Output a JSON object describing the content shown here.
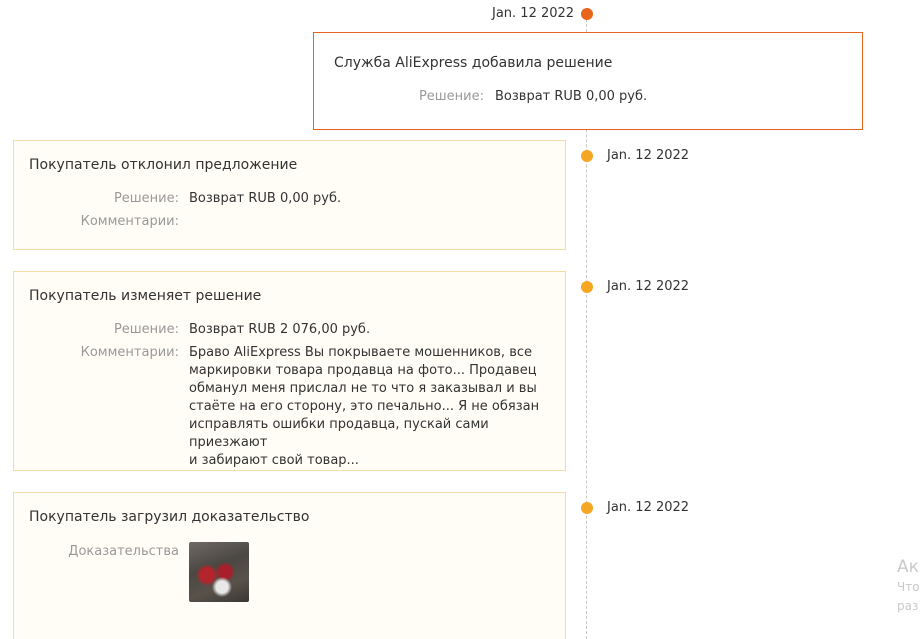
{
  "colors": {
    "accent_orange": "#e8641b",
    "dot_yellow": "#f5a623",
    "card_border": "#f3dca6",
    "label_gray": "#999999"
  },
  "events": [
    {
      "date": "Jan. 12 2022",
      "title": "Служба AliExpress добавила решение",
      "decision_label": "Решение:",
      "decision_value": "Возврат RUB 0,00 руб."
    },
    {
      "date": "Jan. 12 2022",
      "title": "Покупатель отклонил предложение",
      "decision_label": "Решение:",
      "decision_value": "Возврат RUB 0,00 руб.",
      "comment_label": "Комментарии:",
      "comment_value": ""
    },
    {
      "date": "Jan. 12 2022",
      "title": "Покупатель изменяет решение",
      "decision_label": "Решение:",
      "decision_value": "Возврат RUB 2 076,00 руб.",
      "comment_label": "Комментарии:",
      "comment_lines": [
        "Браво AliExpress Вы покрываете мошенников, все",
        "маркировки товара продавца на фото... Продавец",
        "обманул меня прислал не то что я заказывал и вы",
        "стаёте на его сторону, это печально... Я не обязан",
        "исправлять ошибки продавца, пускай сами приезжают",
        "и забирают свой товар..."
      ]
    },
    {
      "date": "Jan. 12 2022",
      "title": "Покупатель загрузил доказательство",
      "evidence_label": "Доказательства"
    }
  ],
  "watermark": {
    "line1": "Ак",
    "line2": "Что",
    "line3": "раз"
  }
}
